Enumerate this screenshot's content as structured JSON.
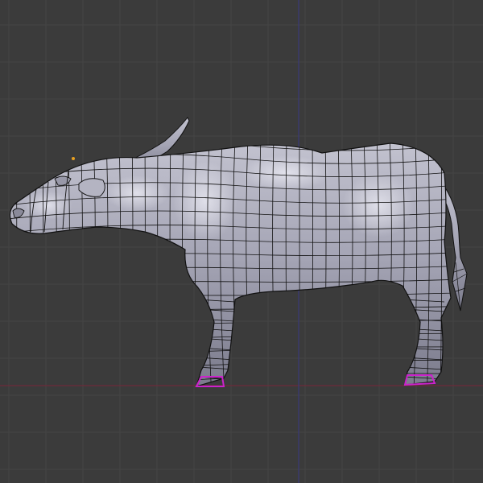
{
  "viewport": {
    "view": "side-orthographic",
    "background_color": "#3b3b3b",
    "grid": true,
    "grid_color": "#444444",
    "x_axis_color": "#6e2a3a",
    "z_axis_color": "#3a3a78"
  },
  "model": {
    "subject": "water-buffalo",
    "mode": "wireframe-on-shaded",
    "mesh_color": "#a9a9b8",
    "wire_color": "#111111",
    "selected_edge_color": "#cc22cc",
    "origin_dot_color": "#e8a020"
  }
}
